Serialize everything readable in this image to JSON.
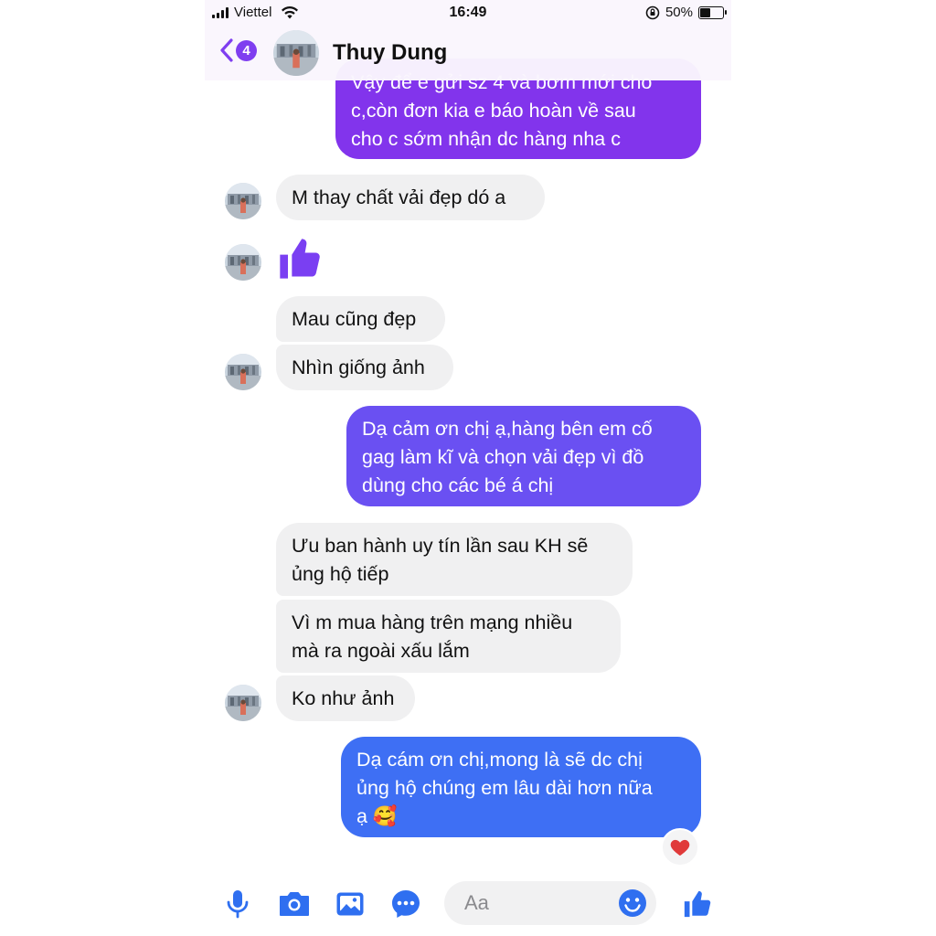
{
  "status_bar": {
    "carrier": "Viettel",
    "time": "16:49",
    "battery_percent": "50%",
    "battery_level": 0.5
  },
  "header": {
    "back_count": "4",
    "contact_name": "Thuy Dung"
  },
  "messages": [
    {
      "type": "outgoing",
      "lines": [
        "Vậy để e gửi sz 4 và bơm mới cho",
        "c,còn đơn kia e báo hoàn về sau",
        "cho c sớm nhận dc hàng nha c"
      ]
    },
    {
      "type": "incoming",
      "lines": [
        "M thay chất vải đẹp dó a"
      ]
    },
    {
      "type": "incoming-sticker",
      "sticker": "thumbs-up"
    },
    {
      "type": "incoming",
      "lines": [
        "Mau cũng đẹp"
      ]
    },
    {
      "type": "incoming",
      "lines": [
        "Nhìn giống ảnh"
      ]
    },
    {
      "type": "outgoing",
      "lines": [
        "Dạ cảm ơn chị ạ,hàng bên em cố",
        "gag làm kĩ và chọn vải đẹp vì đồ",
        "dùng cho các bé á chị"
      ]
    },
    {
      "type": "incoming",
      "lines": [
        "Ưu ban hành uy tín lần sau KH sẽ",
        "ủng hộ tiếp"
      ]
    },
    {
      "type": "incoming",
      "lines": [
        "Vì m mua hàng trên mạng nhiều",
        "mà ra ngoài xấu lắm"
      ]
    },
    {
      "type": "incoming",
      "lines": [
        "Ko như ảnh"
      ]
    },
    {
      "type": "outgoing",
      "lines": [
        "Dạ cám ơn chị,mong là sẽ dc chị",
        "ủng hộ chúng em lâu dài hơn nữa",
        "ạ 🥰"
      ],
      "reaction": "heart"
    }
  ],
  "composer": {
    "placeholder": "Aa",
    "icons": [
      "microphone-icon",
      "camera-icon",
      "photo-icon",
      "chat-bubble-icon",
      "emoji-icon",
      "thumbs-up-icon"
    ]
  },
  "colors": {
    "accent_purple": "#8234ec",
    "accent_violet": "#6a50f2",
    "accent_blue": "#3e6ff4",
    "incoming_bubble": "#f0f0f1",
    "icon_blue": "#2f6ff0",
    "heart": "#e03a3a"
  }
}
